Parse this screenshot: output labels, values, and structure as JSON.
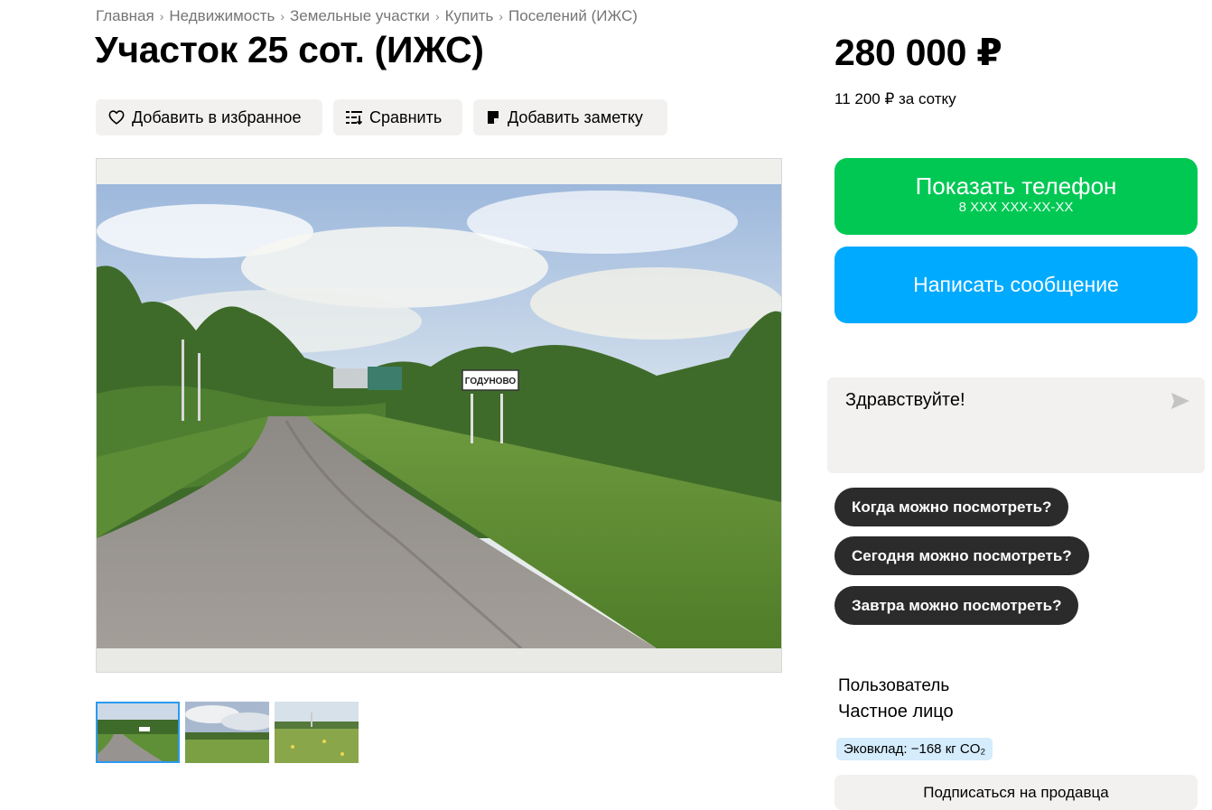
{
  "breadcrumbs": [
    "Главная",
    "Недвижимость",
    "Земельные участки",
    "Купить",
    "Поселений (ИЖС)"
  ],
  "breadcrumb_separator": "›",
  "title": "Участок 25 сот. (ИЖС)",
  "price": "280 000 ₽",
  "price_per_unit": "11 200 ₽ за сотку",
  "actions": {
    "favorite": "Добавить в избранное",
    "compare": "Сравнить",
    "note": "Добавить заметку"
  },
  "photo": {
    "sign_text": "ГОДУНОВО",
    "thumbnails": [
      "road-thumbnail",
      "field-cloudy-thumbnail",
      "meadow-thumbnail"
    ],
    "active_thumbnail": 0
  },
  "contact": {
    "show_phone": "Показать телефон",
    "phone_mask": "8 XXX XXX-XX-XX",
    "write_message": "Написать сообщение"
  },
  "message": {
    "text": "Здравствуйте!",
    "quick_replies": [
      "Когда можно посмотреть?",
      "Сегодня можно посмотреть?",
      "Завтра можно посмотреть?"
    ]
  },
  "seller": {
    "type": "Пользователь",
    "name": "Частное лицо",
    "eco_label": "Эковклад: −168 кг CO₂",
    "subscribe": "Подписаться на продавца"
  },
  "colors": {
    "phone_button": "#00c853",
    "message_button": "#00aaff",
    "chip_background": "#2b2b2b",
    "eco_badge": "#d4ecfc",
    "active_thumb_border": "#2a9bf0"
  }
}
